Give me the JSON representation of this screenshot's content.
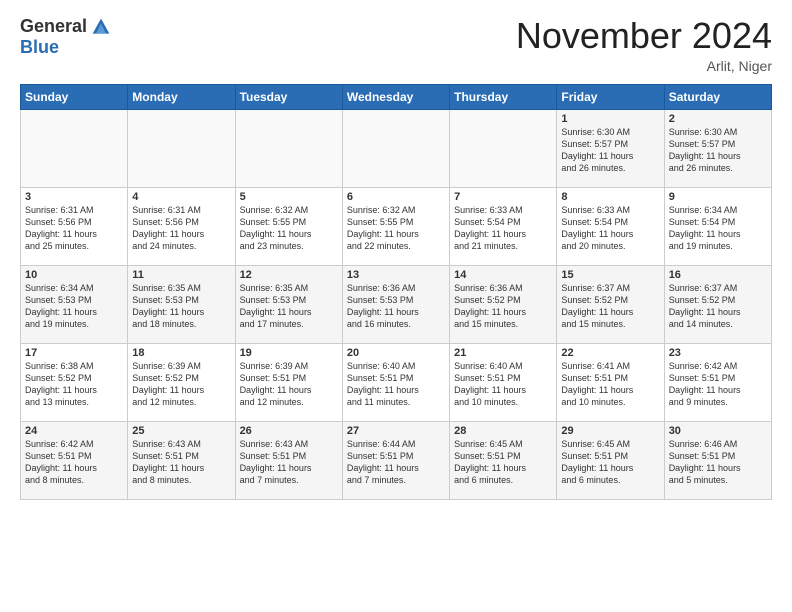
{
  "logo": {
    "general": "General",
    "blue": "Blue"
  },
  "header": {
    "month": "November 2024",
    "location": "Arlit, Niger"
  },
  "weekdays": [
    "Sunday",
    "Monday",
    "Tuesday",
    "Wednesday",
    "Thursday",
    "Friday",
    "Saturday"
  ],
  "weeks": [
    [
      {
        "day": "",
        "info": ""
      },
      {
        "day": "",
        "info": ""
      },
      {
        "day": "",
        "info": ""
      },
      {
        "day": "",
        "info": ""
      },
      {
        "day": "",
        "info": ""
      },
      {
        "day": "1",
        "info": "Sunrise: 6:30 AM\nSunset: 5:57 PM\nDaylight: 11 hours\nand 26 minutes."
      },
      {
        "day": "2",
        "info": "Sunrise: 6:30 AM\nSunset: 5:57 PM\nDaylight: 11 hours\nand 26 minutes."
      }
    ],
    [
      {
        "day": "3",
        "info": "Sunrise: 6:31 AM\nSunset: 5:56 PM\nDaylight: 11 hours\nand 25 minutes."
      },
      {
        "day": "4",
        "info": "Sunrise: 6:31 AM\nSunset: 5:56 PM\nDaylight: 11 hours\nand 24 minutes."
      },
      {
        "day": "5",
        "info": "Sunrise: 6:32 AM\nSunset: 5:55 PM\nDaylight: 11 hours\nand 23 minutes."
      },
      {
        "day": "6",
        "info": "Sunrise: 6:32 AM\nSunset: 5:55 PM\nDaylight: 11 hours\nand 22 minutes."
      },
      {
        "day": "7",
        "info": "Sunrise: 6:33 AM\nSunset: 5:54 PM\nDaylight: 11 hours\nand 21 minutes."
      },
      {
        "day": "8",
        "info": "Sunrise: 6:33 AM\nSunset: 5:54 PM\nDaylight: 11 hours\nand 20 minutes."
      },
      {
        "day": "9",
        "info": "Sunrise: 6:34 AM\nSunset: 5:54 PM\nDaylight: 11 hours\nand 19 minutes."
      }
    ],
    [
      {
        "day": "10",
        "info": "Sunrise: 6:34 AM\nSunset: 5:53 PM\nDaylight: 11 hours\nand 19 minutes."
      },
      {
        "day": "11",
        "info": "Sunrise: 6:35 AM\nSunset: 5:53 PM\nDaylight: 11 hours\nand 18 minutes."
      },
      {
        "day": "12",
        "info": "Sunrise: 6:35 AM\nSunset: 5:53 PM\nDaylight: 11 hours\nand 17 minutes."
      },
      {
        "day": "13",
        "info": "Sunrise: 6:36 AM\nSunset: 5:53 PM\nDaylight: 11 hours\nand 16 minutes."
      },
      {
        "day": "14",
        "info": "Sunrise: 6:36 AM\nSunset: 5:52 PM\nDaylight: 11 hours\nand 15 minutes."
      },
      {
        "day": "15",
        "info": "Sunrise: 6:37 AM\nSunset: 5:52 PM\nDaylight: 11 hours\nand 15 minutes."
      },
      {
        "day": "16",
        "info": "Sunrise: 6:37 AM\nSunset: 5:52 PM\nDaylight: 11 hours\nand 14 minutes."
      }
    ],
    [
      {
        "day": "17",
        "info": "Sunrise: 6:38 AM\nSunset: 5:52 PM\nDaylight: 11 hours\nand 13 minutes."
      },
      {
        "day": "18",
        "info": "Sunrise: 6:39 AM\nSunset: 5:52 PM\nDaylight: 11 hours\nand 12 minutes."
      },
      {
        "day": "19",
        "info": "Sunrise: 6:39 AM\nSunset: 5:51 PM\nDaylight: 11 hours\nand 12 minutes."
      },
      {
        "day": "20",
        "info": "Sunrise: 6:40 AM\nSunset: 5:51 PM\nDaylight: 11 hours\nand 11 minutes."
      },
      {
        "day": "21",
        "info": "Sunrise: 6:40 AM\nSunset: 5:51 PM\nDaylight: 11 hours\nand 10 minutes."
      },
      {
        "day": "22",
        "info": "Sunrise: 6:41 AM\nSunset: 5:51 PM\nDaylight: 11 hours\nand 10 minutes."
      },
      {
        "day": "23",
        "info": "Sunrise: 6:42 AM\nSunset: 5:51 PM\nDaylight: 11 hours\nand 9 minutes."
      }
    ],
    [
      {
        "day": "24",
        "info": "Sunrise: 6:42 AM\nSunset: 5:51 PM\nDaylight: 11 hours\nand 8 minutes."
      },
      {
        "day": "25",
        "info": "Sunrise: 6:43 AM\nSunset: 5:51 PM\nDaylight: 11 hours\nand 8 minutes."
      },
      {
        "day": "26",
        "info": "Sunrise: 6:43 AM\nSunset: 5:51 PM\nDaylight: 11 hours\nand 7 minutes."
      },
      {
        "day": "27",
        "info": "Sunrise: 6:44 AM\nSunset: 5:51 PM\nDaylight: 11 hours\nand 7 minutes."
      },
      {
        "day": "28",
        "info": "Sunrise: 6:45 AM\nSunset: 5:51 PM\nDaylight: 11 hours\nand 6 minutes."
      },
      {
        "day": "29",
        "info": "Sunrise: 6:45 AM\nSunset: 5:51 PM\nDaylight: 11 hours\nand 6 minutes."
      },
      {
        "day": "30",
        "info": "Sunrise: 6:46 AM\nSunset: 5:51 PM\nDaylight: 11 hours\nand 5 minutes."
      }
    ]
  ]
}
